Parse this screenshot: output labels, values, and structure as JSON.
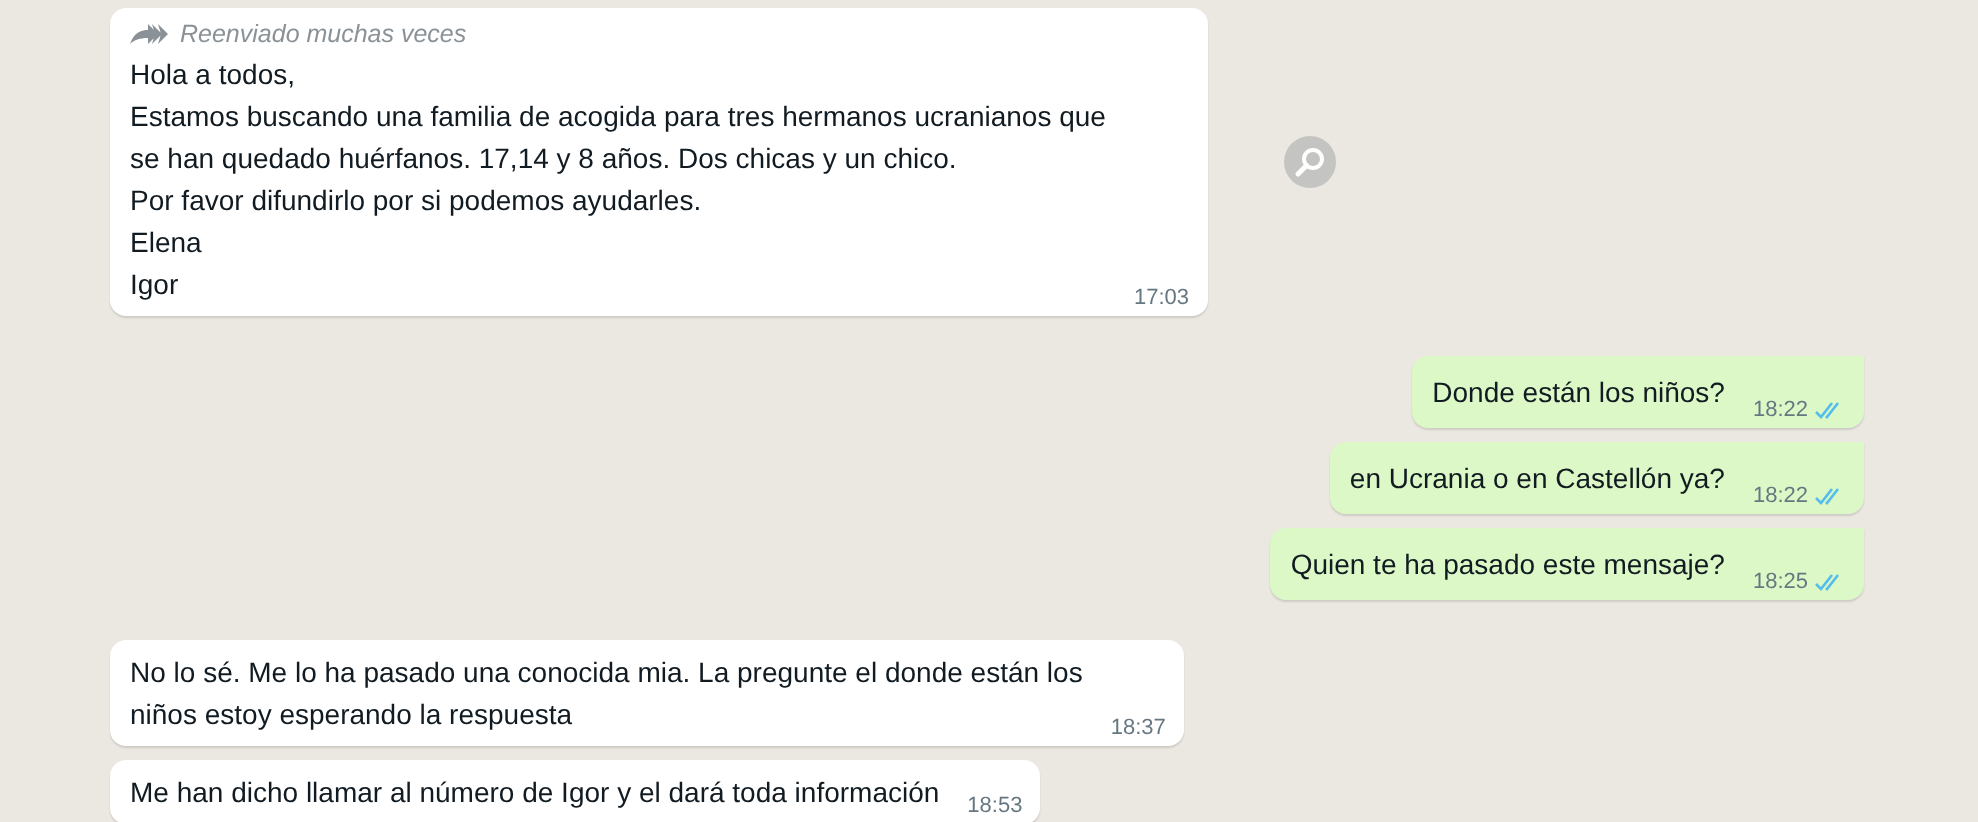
{
  "messages": [
    {
      "kind": "incoming",
      "forwarded_label": "Reenviado muchas veces",
      "lines": [
        "Hola a todos,",
        "Estamos buscando una familia de acogida para tres hermanos ucranianos que",
        "se han quedado huérfanos. 17,14 y 8 años. Dos chicas y un chico.",
        "Por favor difundirlo por si podemos ayudarles.",
        "Elena",
        "Igor"
      ],
      "time": "17:03",
      "search_button": true
    },
    {
      "kind": "outgoing",
      "lines": [
        "Donde están los niños?"
      ],
      "time": "18:22",
      "read": true
    },
    {
      "kind": "outgoing",
      "lines": [
        "en Ucrania o en Castellón ya?"
      ],
      "time": "18:22",
      "read": true
    },
    {
      "kind": "outgoing",
      "lines": [
        "Quien te ha pasado este mensaje?"
      ],
      "time": "18:25",
      "read": true
    },
    {
      "kind": "incoming",
      "lines": [
        "No lo sé. Me lo ha pasado una conocida mia. La pregunte el donde están los",
        "niños estoy esperando la respuesta"
      ],
      "time": "18:37"
    },
    {
      "kind": "incoming",
      "lines": [
        "Me han dicho llamar al número de Igor y el dará toda información"
      ],
      "time": "18:53"
    }
  ]
}
